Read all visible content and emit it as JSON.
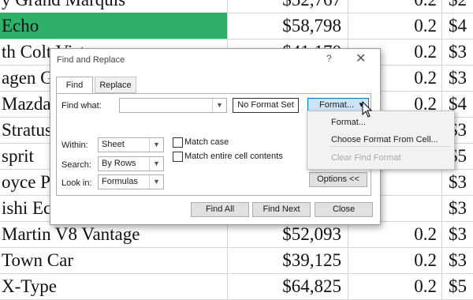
{
  "spreadsheet": {
    "rows": [
      {
        "name": "y Grand Marquis",
        "price": "$52,767",
        "rate": "0.2",
        "last": "$2"
      },
      {
        "name": "Echo",
        "price": "$58,798",
        "rate": "0.2",
        "last": "$4",
        "highlight": true
      },
      {
        "name": "th Colt Vista",
        "price": "$41,170",
        "rate": "0.2",
        "last": "$3"
      },
      {
        "name": "agen G",
        "price": "",
        "rate": "0.2",
        "last": "$3"
      },
      {
        "name": "Mazda",
        "price": "",
        "rate": "0.2",
        "last": "$4"
      },
      {
        "name": "Stratus",
        "price": "",
        "rate": "",
        "last": "$3"
      },
      {
        "name": "sprit",
        "price": "",
        "rate": "",
        "last": "$5"
      },
      {
        "name": "oyce P",
        "price": "",
        "rate": "",
        "last": "$3"
      },
      {
        "name": "ishi Ec",
        "price": "",
        "rate": "",
        "last": "$3"
      },
      {
        "name": "Martin V8 Vantage",
        "price": "$52,093",
        "rate": "0.2",
        "last": "$3"
      },
      {
        "name": " Town Car",
        "price": "$39,125",
        "rate": "0.2",
        "last": "$3"
      },
      {
        "name": "X-Type",
        "price": "$64,825",
        "rate": "0.2",
        "last": "$5"
      }
    ]
  },
  "dialog": {
    "title": "Find and Replace",
    "help": "?",
    "close": "✕",
    "tabs": {
      "find": "Find",
      "replace": "Replace"
    },
    "find_what_label": "Find what:",
    "find_what_value": "",
    "no_format_label": "No Format Set",
    "format_button": "Format...",
    "format_arrow": "▾",
    "within_label": "Within:",
    "within_value": "Sheet",
    "search_label": "Search:",
    "search_value": "By Rows",
    "look_in_label": "Look in:",
    "look_in_value": "Formulas",
    "match_case_label": "Match case",
    "match_entire_label": "Match entire cell contents",
    "options_button": "Options <<",
    "find_all_button": "Find All",
    "find_next_button": "Find Next",
    "close_button": "Close"
  },
  "format_menu": {
    "items": [
      "Format...",
      "Choose Format From Cell...",
      "Clear Find Format"
    ],
    "disabled_index": 2
  },
  "colors": {
    "highlight": "#2fb06a",
    "selected_button": "#cce4f7",
    "selected_border": "#0078d7"
  }
}
